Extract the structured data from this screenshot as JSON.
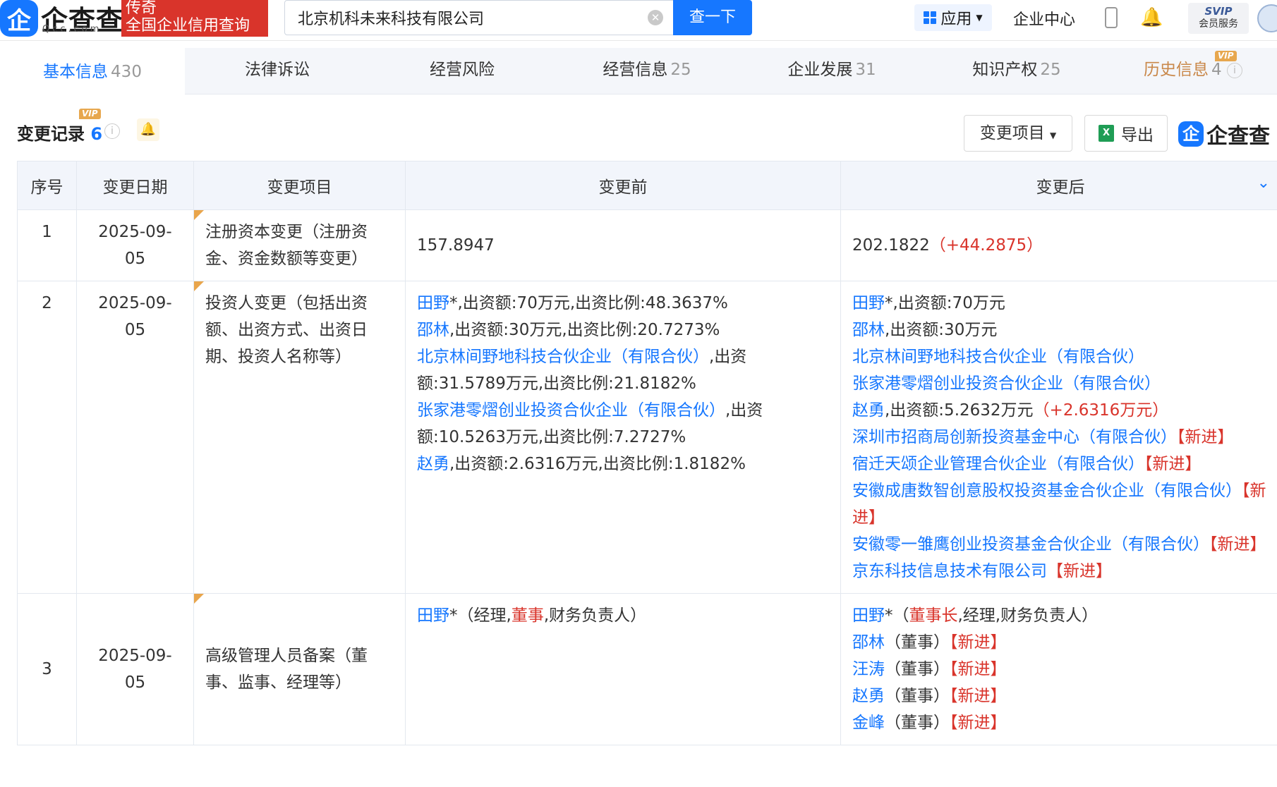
{
  "header": {
    "logo_mark": "企",
    "logo_text": "企查查",
    "logo_sub": "Qcc.com",
    "promo_line1": "传奇",
    "promo_line2": "全国企业信用查询",
    "search_value": "北京机科未来科技有限公司",
    "search_button": "查一下",
    "apps_label": "应用",
    "company_center": "企业中心",
    "svip_line1": "SVIP",
    "svip_line2": "会员服务"
  },
  "tabs": [
    {
      "label": "基本信息",
      "count": "430"
    },
    {
      "label": "法律诉讼",
      "count": ""
    },
    {
      "label": "经营风险",
      "count": ""
    },
    {
      "label": "经营信息",
      "count": "25"
    },
    {
      "label": "企业发展",
      "count": "31"
    },
    {
      "label": "知识产权",
      "count": "25"
    },
    {
      "label": "历史信息",
      "count": "4"
    }
  ],
  "vip_label": "VIP",
  "section": {
    "title": "变更记录",
    "count": "6",
    "dropdown_label": "变更项目",
    "export_label": "导出",
    "watermark_logo": "企查查"
  },
  "table": {
    "headers": [
      "序号",
      "变更日期",
      "变更项目",
      "变更前",
      "变更后"
    ],
    "rows": [
      {
        "index": "1",
        "date": "2025-09-05",
        "item": "注册资本变更（注册资金、资金数额等变更）",
        "before": [
          {
            "text": "157.8947"
          }
        ],
        "after": [
          {
            "text": "202.1822",
            "delta": "（+44.2875）"
          }
        ]
      },
      {
        "index": "2",
        "date": "2025-09-05",
        "item": "投资人变更（包括出资额、出资方式、出资日期、投资人名称等）",
        "before": [
          {
            "link": "田野",
            "text": "*,出资额:70万元,出资比例:48.3637%"
          },
          {
            "link": "邵林",
            "text": ",出资额:30万元,出资比例:20.7273%"
          },
          {
            "link": "北京林间野地科技合伙企业（有限合伙）",
            "text": ",出资额:31.5789万元,出资比例:21.8182%"
          },
          {
            "link": "张家港零熠创业投资合伙企业（有限合伙）",
            "text": ",出资额:10.5263万元,出资比例:7.2727%"
          },
          {
            "link": "赵勇",
            "text": ",出资额:2.6316万元,出资比例:1.8182%"
          }
        ],
        "after": [
          {
            "link": "田野",
            "text": "*,出资额:70万元"
          },
          {
            "link": "邵林",
            "text": ",出资额:30万元"
          },
          {
            "link": "北京林间野地科技合伙企业（有限合伙）"
          },
          {
            "link": "张家港零熠创业投资合伙企业（有限合伙）"
          },
          {
            "link": "赵勇",
            "text": ",出资额:5.2632万元",
            "delta": "（+2.6316万元）"
          },
          {
            "link": "深圳市招商局创新投资基金中心（有限合伙）",
            "tag": "【新进】"
          },
          {
            "link": "宿迁天颂企业管理合伙企业（有限合伙）",
            "tag": "【新进】"
          },
          {
            "link": "安徽成唐数智创意股权投资基金合伙企业（有限合伙）",
            "tag": "【新进】"
          },
          {
            "link": "安徽零一雏鹰创业投资基金合伙企业（有限合伙）",
            "tag": "【新进】"
          },
          {
            "link": "京东科技信息技术有限公司",
            "tag": "【新进】"
          }
        ]
      },
      {
        "index": "3",
        "date": "2025-09-05",
        "item": "高级管理人员备案（董事、监事、经理等）",
        "before": [
          {
            "link": "田野",
            "text": "*（经理,",
            "red": "董事",
            "text2": ",财务负责人）"
          }
        ],
        "after": [
          {
            "link": "田野",
            "text": "*（",
            "red": "董事长",
            "text2": ",经理,财务负责人）"
          },
          {
            "link": "邵林",
            "text": "（董事）",
            "tag": "【新进】"
          },
          {
            "link": "汪涛",
            "text": "（董事）",
            "tag": "【新进】"
          },
          {
            "link": "赵勇",
            "text": "（董事）",
            "tag": "【新进】"
          },
          {
            "link": "金峰",
            "text": "（董事）",
            "tag": "【新进】"
          }
        ]
      }
    ]
  }
}
